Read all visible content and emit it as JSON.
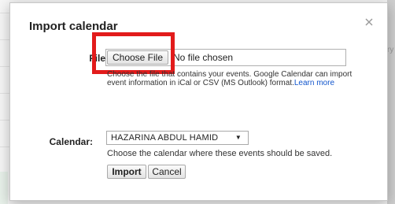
{
  "background": {
    "side_text": "ry"
  },
  "dialog": {
    "title": "Import calendar",
    "close_symbol": "×",
    "file": {
      "label": "File:",
      "choose_button_label": "Choose File",
      "status_text": "No file chosen",
      "help_text": "Choose the file that contains your events. Google Calendar can import event information in iCal or CSV (MS Outlook) format.",
      "learn_more_label": "Learn more"
    },
    "calendar": {
      "label": "Calendar:",
      "selected_value": "HAZARINA ABDUL HAMID",
      "dropdown_arrow": "▼",
      "hint": "Choose the calendar where these events should be saved."
    },
    "actions": {
      "import_label": "Import",
      "cancel_label": "Cancel"
    }
  },
  "colors": {
    "highlight": "#e21b1b",
    "link": "#1155cc"
  },
  "icons": {
    "close": "close-icon"
  }
}
